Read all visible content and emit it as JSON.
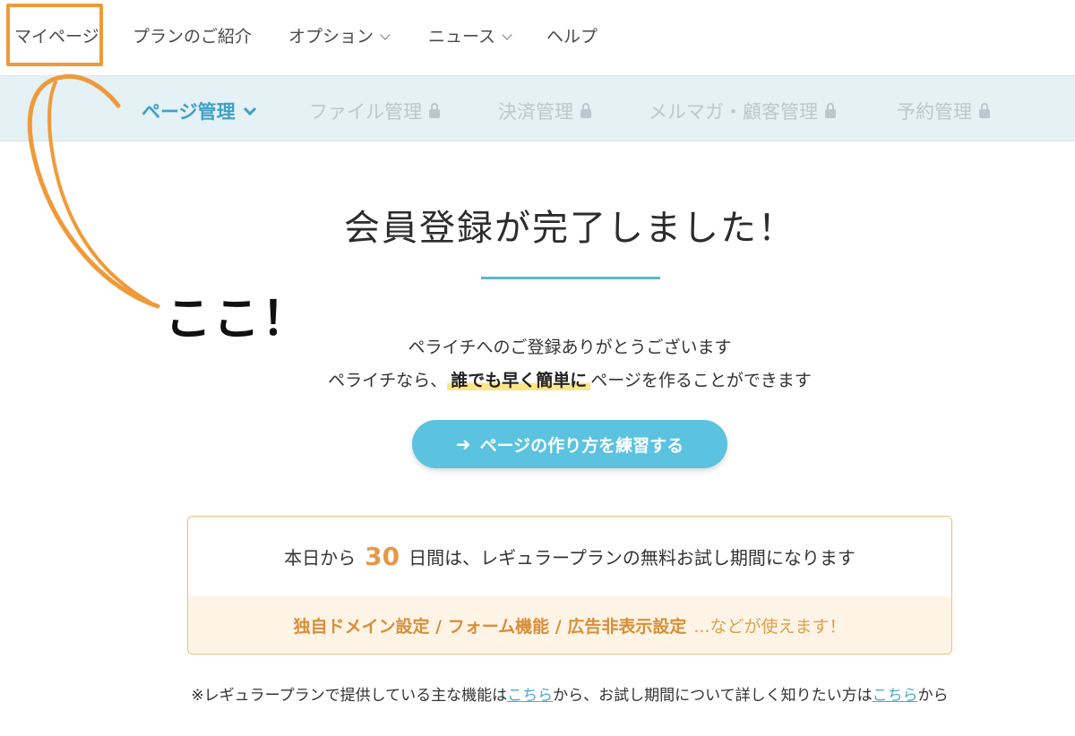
{
  "topnav": {
    "items": [
      {
        "label": "マイページ"
      },
      {
        "label": "プランのご紹介"
      },
      {
        "label": "オプション"
      },
      {
        "label": "ニュース"
      },
      {
        "label": "ヘルプ"
      }
    ]
  },
  "subnav": {
    "items": [
      {
        "label": "ページ管理"
      },
      {
        "label": "ファイル管理"
      },
      {
        "label": "決済管理"
      },
      {
        "label": "メルマガ・顧客管理"
      },
      {
        "label": "予約管理"
      }
    ]
  },
  "main": {
    "title": "会員登録が完了しました！",
    "line1": "ペライチへのご登録ありがとうございます",
    "line2_pre": "ペライチなら、",
    "line2_highlight": "誰でも早く簡単に",
    "line2_post": "ページを作ることができます",
    "cta_icon": "arrow-right-icon",
    "cta_label": "ページの作り方を練習する"
  },
  "trial": {
    "pre": "本日から",
    "days": "30",
    "post": "日間は、レギュラープランの無料お試し期間になります",
    "features": "独自ドメイン設定 / フォーム機能 / 広告非表示設定",
    "features_tail": "...などが使えます！"
  },
  "footnote": {
    "part1": "※レギュラープランで提供している主な機能は",
    "link1": "こちら",
    "part2": "から、お試し期間について詳しく知りたい方は",
    "link2": "こちら",
    "part3": "から"
  },
  "annotation": {
    "text": "ここ！",
    "color": "#ef9a3a"
  },
  "colors": {
    "accent": "#5bc2e0",
    "subnav_bg": "#e4f1f5",
    "trial_orange": "#e39a47"
  }
}
